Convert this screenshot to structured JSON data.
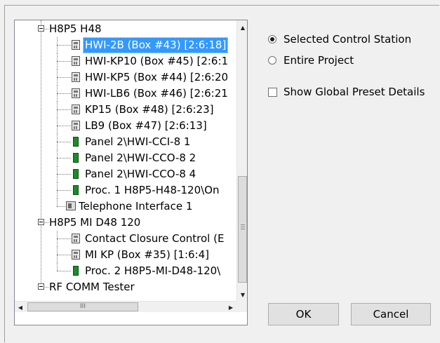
{
  "tree": {
    "rows": [
      {
        "label": "H8P5 H48",
        "kind": "group"
      },
      {
        "label": "HWI-2B (Box #43) [2:6:18]",
        "kind": "device",
        "selected": true
      },
      {
        "label": "HWI-KP10 (Box #45) [2:6:1",
        "kind": "device"
      },
      {
        "label": "HWI-KP5 (Box #44) [2:6:20",
        "kind": "device"
      },
      {
        "label": "HWI-LB6 (Box #46) [2:6:21",
        "kind": "device"
      },
      {
        "label": "KP15 (Box #48) [2:6:23]",
        "kind": "device"
      },
      {
        "label": "LB9 (Box #47) [2:6:13]",
        "kind": "device"
      },
      {
        "label": "Panel 2\\HWI-CCI-8 1",
        "kind": "panel"
      },
      {
        "label": "Panel 2\\HWI-CCO-8 2",
        "kind": "panel"
      },
      {
        "label": "Panel 2\\HWI-CCO-8 4",
        "kind": "panel"
      },
      {
        "label": "Proc. 1 H8P5-H48-120\\On",
        "kind": "panel"
      },
      {
        "label": "Telephone Interface 1",
        "kind": "phone"
      },
      {
        "label": "H8P5 MI D48 120",
        "kind": "group"
      },
      {
        "label": "Contact Closure Control (E",
        "kind": "device"
      },
      {
        "label": "MI KP (Box #35) [1:6:4]",
        "kind": "device"
      },
      {
        "label": "Proc. 2 H8P5-MI-D48-120\\",
        "kind": "panel"
      },
      {
        "label": "RF COMM Tester",
        "kind": "group"
      }
    ],
    "scroll_h_label": "III"
  },
  "options": {
    "selected_station": "Selected Control Station",
    "entire_project": "Entire Project",
    "scope_selected": "selected_station",
    "show_global": "Show Global Preset Details",
    "show_global_checked": false
  },
  "buttons": {
    "ok": "OK",
    "cancel": "Cancel"
  }
}
